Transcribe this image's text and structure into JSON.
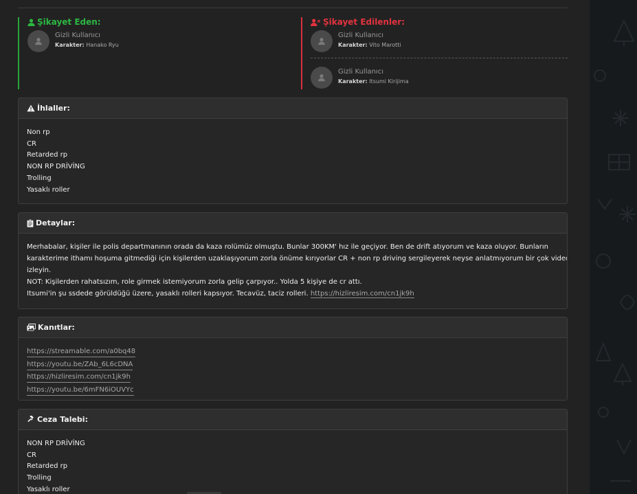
{
  "complainant": {
    "title": "Şikayet Eden:",
    "users": [
      {
        "name": "Gizli Kullanıcı",
        "char_label": "Karakter:",
        "char_value": "Hanako Ryu"
      }
    ]
  },
  "accused": {
    "title": "Şikayet Edilenler:",
    "users": [
      {
        "name": "Gizli Kullanıcı",
        "char_label": "Karakter:",
        "char_value": "Vito Marotti"
      },
      {
        "name": "Gizli Kullanıcı",
        "char_label": "Karakter:",
        "char_value": "Itsumi Kirijima"
      }
    ]
  },
  "violations": {
    "title": "İhlaller:",
    "items": [
      "Non rp",
      "CR",
      "Retarded rp",
      "NON RP DRİVİNG",
      "Trolling",
      "Yasaklı roller"
    ]
  },
  "details": {
    "title": "Detaylar:",
    "lines": [
      "Merhabalar, kişiler ile polis departmanının orada da kaza rolümüz olmuştu. Bunlar 300KM' hız ile geçiyor. Ben de drift atıyorum ve kaza oluyor. Bunların",
      "karakterime ithamı hoşuma gitmediği için kişilerden uzaklaşıyorum zorla önüme kırıyorlar CR + non rp driving sergileyerek neyse anlatmıyorum bir çok video var",
      "izleyin.",
      "NOT: Kişilerden rahatsızım, role girmek istemiyorum zorla gelip çarpıyor.. Yolda 5 kişiye de cr attı."
    ],
    "last_line_text": "Itsumi'in şu ssdede görüldüğü üzere, yasaklı rolleri kapsıyor. Tecavüz, taciz rolleri. ",
    "last_line_link": "https://hizliresim.com/cn1jk9h"
  },
  "evidence": {
    "title": "Kanıtlar:",
    "links": [
      "https://streamable.com/a0bq48",
      "https://youtu.be/ZAb_6L6cDNA",
      "https://hizliresim.com/cn1jk9h",
      "https://youtu.be/6mFN6iOUVYc"
    ]
  },
  "penalty": {
    "title": "Ceza Talebi:",
    "items": [
      "NON RP DRİVİNG",
      "CR",
      "Retarded rp",
      "Trolling",
      "Yasaklı roller"
    ]
  },
  "colors": {
    "complainant_accent": "#27a63b",
    "accused_accent": "#d9303d",
    "background": "#222222",
    "panel_header": "#2e2e2e"
  },
  "icons": {
    "complainant": "user-icon",
    "accused": "user-times-icon",
    "violations": "warning-icon",
    "details": "clipboard-icon",
    "evidence": "images-icon",
    "penalty": "gavel-icon"
  }
}
